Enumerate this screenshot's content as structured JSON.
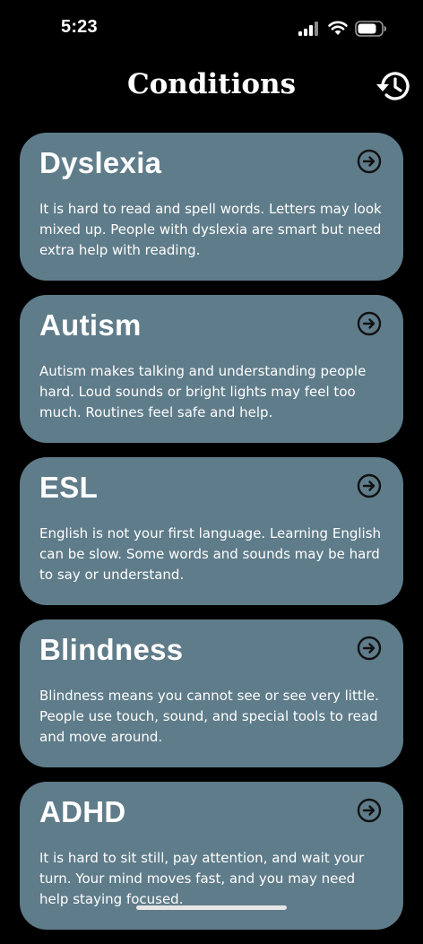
{
  "status_bar": {
    "time": "5:23",
    "icons": [
      "signal-icon",
      "wifi-icon",
      "battery-icon"
    ]
  },
  "header": {
    "title": "Conditions",
    "history_icon": "history-icon"
  },
  "cards": [
    {
      "title": "Dyslexia",
      "description": "It is hard to read and spell words. Letters may look mixed up. People with dyslexia are smart but need extra help with reading."
    },
    {
      "title": "Autism",
      "description": "Autism makes talking and understanding people hard. Loud sounds or bright lights may feel too much. Routines feel safe and help."
    },
    {
      "title": "ESL",
      "description": "English is not your first language. Learning English can be slow. Some words and sounds may be hard to say or understand."
    },
    {
      "title": "Blindness",
      "description": "Blindness means you cannot see or see very little. People use touch, sound, and special tools to read and move around."
    },
    {
      "title": "ADHD",
      "description": "It is hard to sit still, pay attention, and wait your turn. Your mind moves fast, and you may need help staying focused."
    }
  ],
  "colors": {
    "background": "#000000",
    "card": "#5f7c8a",
    "text": "#ffffff",
    "arrow_icon": "#111111"
  }
}
